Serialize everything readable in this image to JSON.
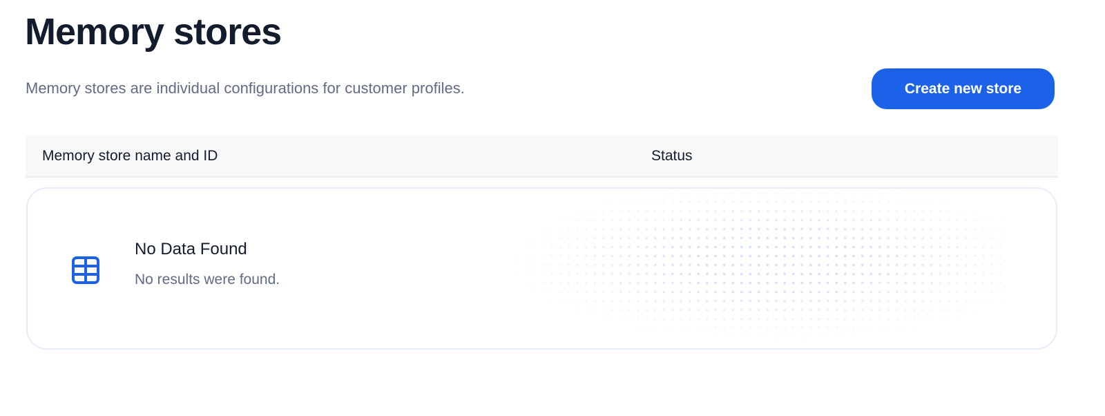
{
  "header": {
    "title": "Memory stores",
    "description": "Memory stores are individual configurations for customer profiles.",
    "create_button_label": "Create new store"
  },
  "table": {
    "columns": [
      {
        "label": "Memory store name and ID"
      },
      {
        "label": "Status"
      }
    ],
    "empty_state": {
      "icon": "table-icon",
      "title": "No Data Found",
      "message": "No results were found."
    }
  },
  "colors": {
    "primary_button": "#1c62e8",
    "title_text": "#121c2d",
    "secondary_text": "#606b85",
    "header_background": "#f8f8f8"
  }
}
